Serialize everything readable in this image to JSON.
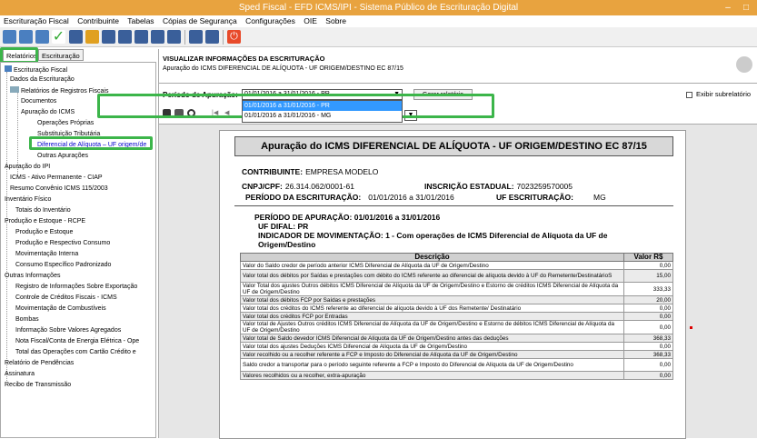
{
  "window": {
    "title": "Sped Fiscal - EFD ICMS/IPI - Sistema Público de Escrituração Digital",
    "minimize": "–",
    "maximize": "□"
  },
  "menu": [
    "Escrituração Fiscal",
    "Contribuinte",
    "Tabelas",
    "Cópias de Segurança",
    "Configurações",
    "OIE",
    "Sobre"
  ],
  "tabs": {
    "relatorios": "Relatórios",
    "escrituracao": "Escrituração"
  },
  "tree": [
    "Escrituração Fiscal",
    "Dados da Escrituração",
    "Relatórios de Registros Fiscais",
    "Documentos",
    "Apuração do ICMS",
    "Operações Próprias",
    "Substituição Tributária",
    "Diferencial de Alíquota – UF origem/de",
    "Outras Apurações",
    "Apuração do IPI",
    "ICMS - Ativo Permanente - CIAP",
    "Resumo Convênio ICMS 115/2003",
    "Inventário Físico",
    "Totais do Inventário",
    "Produção e Estoque - RCPE",
    "Produção e Estoque",
    "Produção e Respectivo Consumo",
    "Movimentação Interna",
    "Consumo Específico Padronizado",
    "Outras Informações",
    "Registro de Informações Sobre Exportação",
    "Controle de Créditos Fiscais - ICMS",
    "Movimentação de Combustíveis",
    "Bombas",
    "Informação Sobre Valores Agregados",
    "Nota Fiscal/Conta de Energia Elétrica - Ope",
    "Total das Operações com Cartão Crédito e",
    "Relatório de Pendências",
    "Assinatura",
    "Recibo de Transmissão"
  ],
  "header": {
    "title": "VISUALIZAR INFORMAÇÕES DA ESCRITURAÇÃO",
    "subtitle": "Apuração do ICMS DIFERENCIAL DE ALÍQUOTA - UF ORIGEM/DESTINO EC 87/15"
  },
  "period": {
    "label": "Período de Apuração:",
    "selected": "01/01/2016 a 31/01/2016 - PR",
    "options": [
      "01/01/2016 a 31/01/2016 - PR",
      "01/01/2016 a 31/01/2016 - MG"
    ],
    "generate": "Gerar relatório",
    "subreport": "Exibir subrelatório"
  },
  "report": {
    "title": "Apuração do ICMS DIFERENCIAL DE ALÍQUOTA - UF ORIGEM/DESTINO EC 87/15",
    "contribuinte_label": "CONTRIBUINTE:",
    "contribuinte": "EMPRESA MODELO",
    "cnpj_label": "CNPJ/CPF:",
    "cnpj": "26.314.062/0001-61",
    "ie_label": "INSCRIÇÃO ESTADUAL:",
    "ie": "7023259570005",
    "period_label": "PERÍODO DA ESCRITURAÇÃO:",
    "period": "01/01/2016 a 31/01/2016",
    "uf_label": "UF ESCRITURAÇÃO:",
    "uf": "MG",
    "apuracao": "PERÍODO DE APURAÇÃO: 01/01/2016 a 31/01/2016",
    "difal": "UF DIFAL: PR",
    "indicador": "INDICADOR DE MOVIMENTAÇÃO: 1 - Com operações de ICMS Diferencial de Alíquota da UF de Origem/Destino",
    "col_desc": "Descrição",
    "col_val": "Valor R$",
    "rows": [
      {
        "d": "Valor do Saldo credor de período anterior ICMS Diferencial de Alíquota da UF de Origem/Destino",
        "v": "0,00"
      },
      {
        "d": "Valor total dos débitos por Saídas e prestações com débito do ICMS referente ao diferencial de alíquota devido à UF do Remetente/DestinatárioS",
        "v": "15,00"
      },
      {
        "d": "Valor Total dos ajustes Outros débitos ICMS Diferencial de Alíquota da UF de Origem/Destino e Estorno de créditos ICMS Diferencial de Alíquota da UF de Origem/Destino",
        "v": "333,33"
      },
      {
        "d": "Valor total dos débitos FCP por Saídas e prestações",
        "v": "20,00"
      },
      {
        "d": "Valor total dos créditos do ICMS referente ao diferencial de alíquota devido à UF dos Remetente/ Destinatário",
        "v": "0,00"
      },
      {
        "d": "Valor total dos créditos FCP por Entradas",
        "v": "0,00"
      },
      {
        "d": "Valor total de Ajustes Outros créditos ICMS Diferencial de Alíquota da UF de Origem/Destino e Estorno de débitos ICMS Diferencial de Alíquota da UF de Origem/Destino",
        "v": "0,00"
      },
      {
        "d": "Valor total de Saldo devedor ICMS Diferencial de Alíquota da UF de Origem/Destino antes das deduções",
        "v": "368,33"
      },
      {
        "d": "Valor total dos ajustes Deduções ICMS Diferencial de Alíquota da UF de Origem/Destino",
        "v": "0,00"
      },
      {
        "d": "Valor recolhido ou a recolher referente a FCP e Imposto do Diferencial de Alíquota da UF de Origem/Destino",
        "v": "368,33"
      },
      {
        "d": "Saldo credor a transportar para o período seguinte referente a FCP e Imposto do Diferencial de Alíquota da UF de Origem/Destino",
        "v": "0,00"
      },
      {
        "d": "Valores recolhidos ou a recolher, extra-apuração",
        "v": "0,00"
      }
    ]
  }
}
